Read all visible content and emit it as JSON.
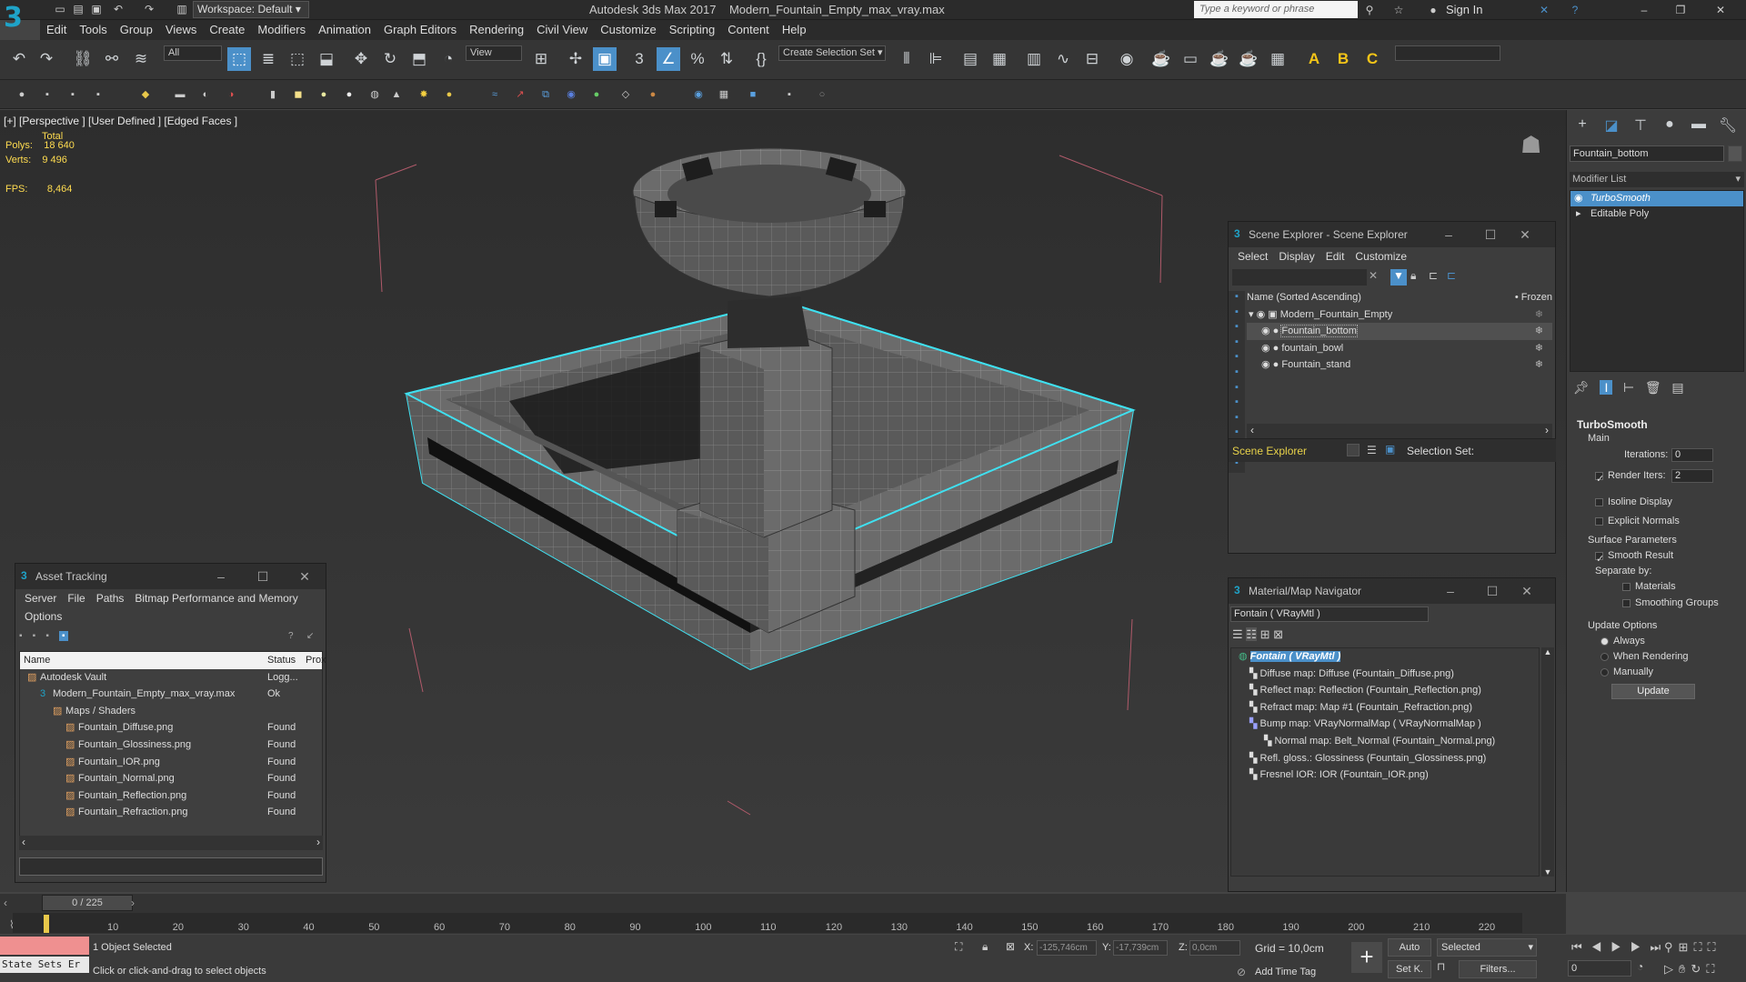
{
  "app": {
    "title": "Autodesk 3ds Max 2017",
    "file": "Modern_Fountain_Empty_max_vray.max",
    "workspace": "Workspace: Default",
    "search_placeholder": "Type a keyword or phrase",
    "sign_in": "Sign In"
  },
  "menu": [
    "Edit",
    "Tools",
    "Group",
    "Views",
    "Create",
    "Modifiers",
    "Animation",
    "Graph Editors",
    "Rendering",
    "Civil View",
    "Customize",
    "Scripting",
    "Content",
    "Help"
  ],
  "toolbar": {
    "filter": "All",
    "view": "View",
    "selection_set": "Create Selection Set"
  },
  "viewport": {
    "label": "[+] [Perspective ] [User Defined ] [Edged Faces ]",
    "total": "Total",
    "polys_label": "Polys:",
    "polys": "18 640",
    "verts_label": "Verts:",
    "verts": "9 496",
    "fps_label": "FPS:",
    "fps": "8,464",
    "accent": "#3fe0f0"
  },
  "command_panel": {
    "object_name": "Fountain_bottom",
    "modifier_list": "Modifier List",
    "stack": [
      "TurboSmooth",
      "Editable Poly"
    ],
    "rollout": "TurboSmooth",
    "main": "Main",
    "iterations_label": "Iterations:",
    "iterations": "0",
    "render_iters_label": "Render Iters:",
    "render_iters": "2",
    "isoline": "Isoline Display",
    "explicit_normals": "Explicit Normals",
    "surface_params": "Surface Parameters",
    "smooth_result": "Smooth Result",
    "separate_by": "Separate by:",
    "materials": "Materials",
    "smoothing_groups": "Smoothing Groups",
    "update_options": "Update Options",
    "always": "Always",
    "when_rendering": "When Rendering",
    "manually": "Manually",
    "update_btn": "Update"
  },
  "scene_explorer": {
    "title": "Scene Explorer - Scene Explorer",
    "menu": [
      "Select",
      "Display",
      "Edit",
      "Customize"
    ],
    "col_name": "Name (Sorted Ascending)",
    "col_frozen": "• Frozen",
    "root": "Modern_Fountain_Empty",
    "items": [
      "Fountain_bottom",
      "fountain_bowl",
      "Fountain_stand"
    ],
    "footer": "Scene Explorer",
    "selection_set": "Selection Set:"
  },
  "material_nav": {
    "title": "Material/Map Navigator",
    "field": "Fontain  ( VRayMtl )",
    "root": "Fontain  ( VRayMtl )",
    "items": [
      "Diffuse map: Diffuse (Fountain_Diffuse.png)",
      "Reflect map: Reflection (Fountain_Reflection.png)",
      "Refract map: Map #1 (Fountain_Refraction.png)",
      "Bump map: VRayNormalMap  ( VRayNormalMap )",
      "Normal map: Belt_Normal (Fountain_Normal.png)",
      "Refl. gloss.: Glossiness (Fountain_Glossiness.png)",
      "Fresnel IOR: IOR (Fountain_IOR.png)"
    ]
  },
  "asset_tracking": {
    "title": "Asset Tracking",
    "menu": [
      "Server",
      "File",
      "Paths",
      "Bitmap Performance and Memory"
    ],
    "menu2": "Options",
    "columns": [
      "Name",
      "Status",
      "Prox"
    ],
    "rows": [
      {
        "name": "Autodesk Vault",
        "status": "Logg..."
      },
      {
        "name": "Modern_Fountain_Empty_max_vray.max",
        "status": "Ok"
      },
      {
        "name": "Maps / Shaders",
        "status": ""
      },
      {
        "name": "Fountain_Diffuse.png",
        "status": "Found"
      },
      {
        "name": "Fountain_Glossiness.png",
        "status": "Found"
      },
      {
        "name": "Fountain_IOR.png",
        "status": "Found"
      },
      {
        "name": "Fountain_Normal.png",
        "status": "Found"
      },
      {
        "name": "Fountain_Reflection.png",
        "status": "Found"
      },
      {
        "name": "Fountain_Refraction.png",
        "status": "Found"
      }
    ]
  },
  "timeline": {
    "frame": "0 / 225",
    "ticks": [
      "10",
      "20",
      "30",
      "40",
      "50",
      "60",
      "70",
      "80",
      "90",
      "100",
      "110",
      "120",
      "130",
      "140",
      "150",
      "160",
      "170",
      "180",
      "190",
      "200",
      "210",
      "220"
    ]
  },
  "status": {
    "script": "State Sets Er",
    "selected": "1 Object Selected",
    "prompt": "Click or click-and-drag to select objects",
    "x_label": "X:",
    "x": "-125,746cm",
    "y_label": "Y:",
    "y": "-17,739cm",
    "z_label": "Z:",
    "z": "0,0cm",
    "grid": "Grid = 10,0cm",
    "auto": "Auto",
    "selected_dd": "Selected",
    "setk": "Set K.",
    "filters": "Filters...",
    "add_time_tag": "Add Time Tag",
    "frame": "0"
  }
}
